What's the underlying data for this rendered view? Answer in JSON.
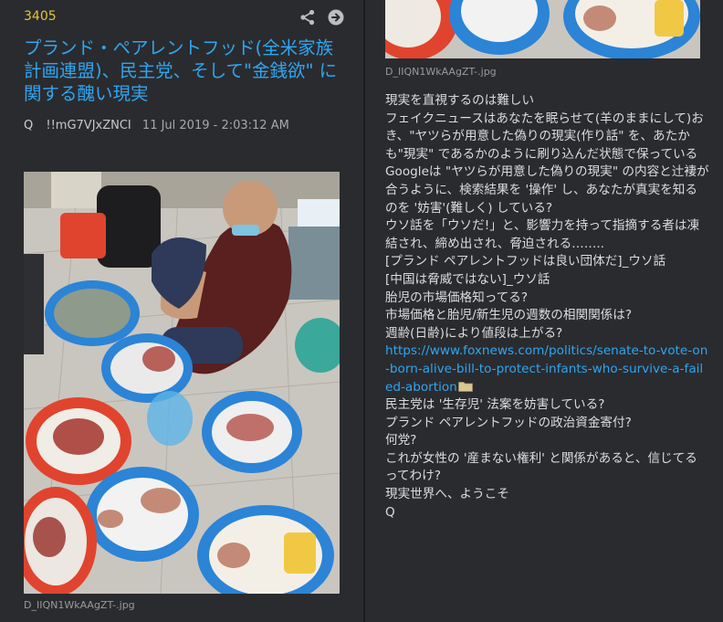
{
  "left_post": {
    "number": "3405",
    "title": "プランド・ペアレントフッド(全米家族計画連盟)、民主党、そして\"金銭欲\" に関する醜い現実",
    "signature": "Q",
    "tripcode": "!!mG7VJxZNCI",
    "date": "11 Jul 2019 - 2:03:12 AM",
    "image_filename": "D_IIQN1WkAAgZT-.jpg",
    "icons": {
      "share": "share-icon",
      "open": "arrow-right-circle-icon"
    }
  },
  "right_post": {
    "image_filename": "D_IIQN1WkAAgZT-.jpg",
    "lines": [
      "現実を直視するのは難しい",
      "フェイクニュースはあなたを眠らせて(羊のままにして)おき、\"ヤツらが用意した偽りの現実(作り話\" を、あたかも\"現実\" であるかのように刷り込んだ状態で保っている",
      "Googleは \"ヤツらが用意した偽りの現実\" の内容と辻褄が合うように、検索結果を '操作' し、あなたが真実を知るのを '妨害'(難しく) している?",
      "ウソ話を「ウソだ!」と、影響力を持って指摘する者は凍結され、締め出され、脅迫される……..",
      "[プランド ペアレントフッドは良い団体だ]_ウソ話",
      "[中国は脅威ではない]_ウソ話",
      "胎児の市場価格知ってる?",
      "市場価格と胎児/新生児の週数の相関関係は?",
      "週齢(日齢)により値段は上がる?"
    ],
    "link": "https://www.foxnews.com/politics/senate-to-vote-on-born-alive-bill-to-protect-infants-who-survive-a-failed-abortion",
    "lines_after": [
      "民主党は '生存児' 法案を妨害している?",
      "プランド ペアレントフッドの政治資金寄付?",
      "何党?",
      "これが女性の '産まない権利' と関係があると、信じてるってわけ?",
      "現実世界へ、ようこそ",
      "Q"
    ]
  },
  "colors": {
    "title": "#2ea6f0",
    "post_number": "#e7c33a",
    "link": "#2ea6f0",
    "panel": "#2a2b2f"
  }
}
